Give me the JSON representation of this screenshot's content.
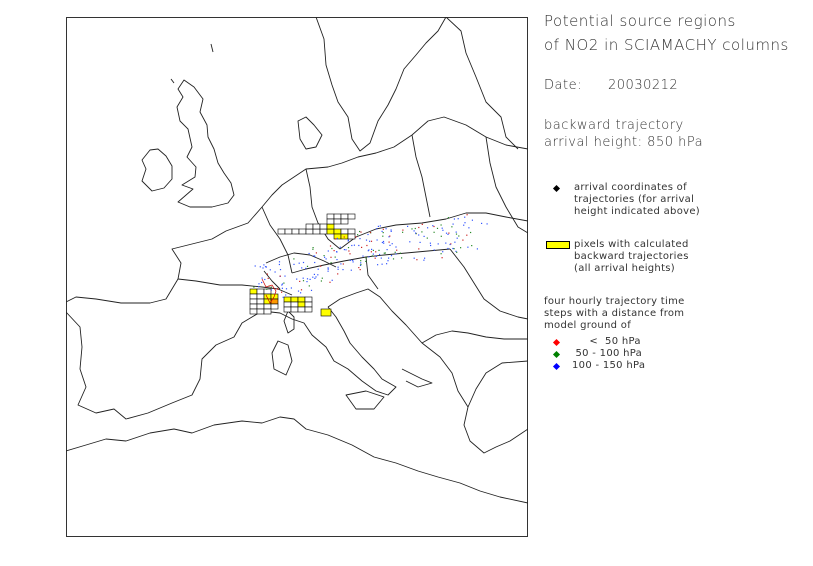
{
  "title": {
    "line1": "Potential source regions",
    "line2": "of NO2 in SCIAMACHY columns"
  },
  "date": {
    "label": "Date:",
    "value": "20030212"
  },
  "trajectory": {
    "line1": "backward trajectory",
    "line2": "arrival height: 850 hPa"
  },
  "legend": {
    "arrival": {
      "line1": "arrival coordinates of",
      "line2": "trajectories (for arrival",
      "line3": "height indicated above)",
      "color": "#000000"
    },
    "pixels": {
      "line1": "pixels with calculated",
      "line2": "backward trajectories",
      "line3": "(all arrival heights)",
      "color": "#ffff00"
    },
    "timesteps": {
      "line1": "four hourly trajectory time",
      "line2": "steps with a distance from",
      "line3": "model ground of"
    },
    "classes": [
      {
        "range": "     <  50 hPa",
        "color": "#ff0000"
      },
      {
        "range": " 50 - 100 hPa",
        "color": "#008000"
      },
      {
        "range": "100 - 150 hPa",
        "color": "#0000ff"
      }
    ]
  },
  "map_icons": {
    "coastlines": "europe-coastline-icon"
  }
}
